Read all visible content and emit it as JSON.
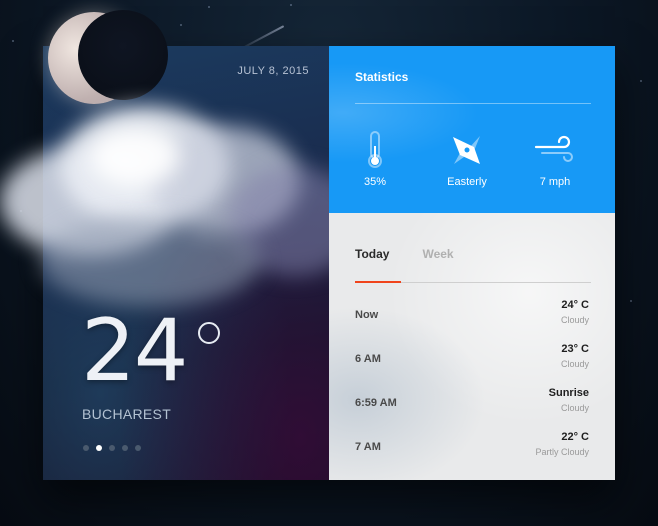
{
  "weather": {
    "date": "JULY 8, 2015",
    "temperature": "24",
    "city": "BUCHAREST",
    "pagination": {
      "total": 5,
      "active_index": 1
    }
  },
  "statistics": {
    "title": "Statistics",
    "items": [
      {
        "icon": "thermometer-icon",
        "value": "35%"
      },
      {
        "icon": "compass-icon",
        "value": "Easterly"
      },
      {
        "icon": "wind-icon",
        "value": "7 mph"
      }
    ]
  },
  "forecast": {
    "tabs": [
      {
        "label": "Today",
        "active": true
      },
      {
        "label": "Week",
        "active": false
      }
    ],
    "rows": [
      {
        "time": "Now",
        "temp": "24° C",
        "condition": "Cloudy"
      },
      {
        "time": "6 AM",
        "temp": "23° C",
        "condition": "Cloudy"
      },
      {
        "time": "6:59 AM",
        "temp": "Sunrise",
        "condition": "Cloudy"
      },
      {
        "time": "7 AM",
        "temp": "22° C",
        "condition": "Partly Cloudy"
      }
    ]
  },
  "colors": {
    "accent_blue": "#1799f6",
    "tab_indicator": "#f0441c"
  }
}
